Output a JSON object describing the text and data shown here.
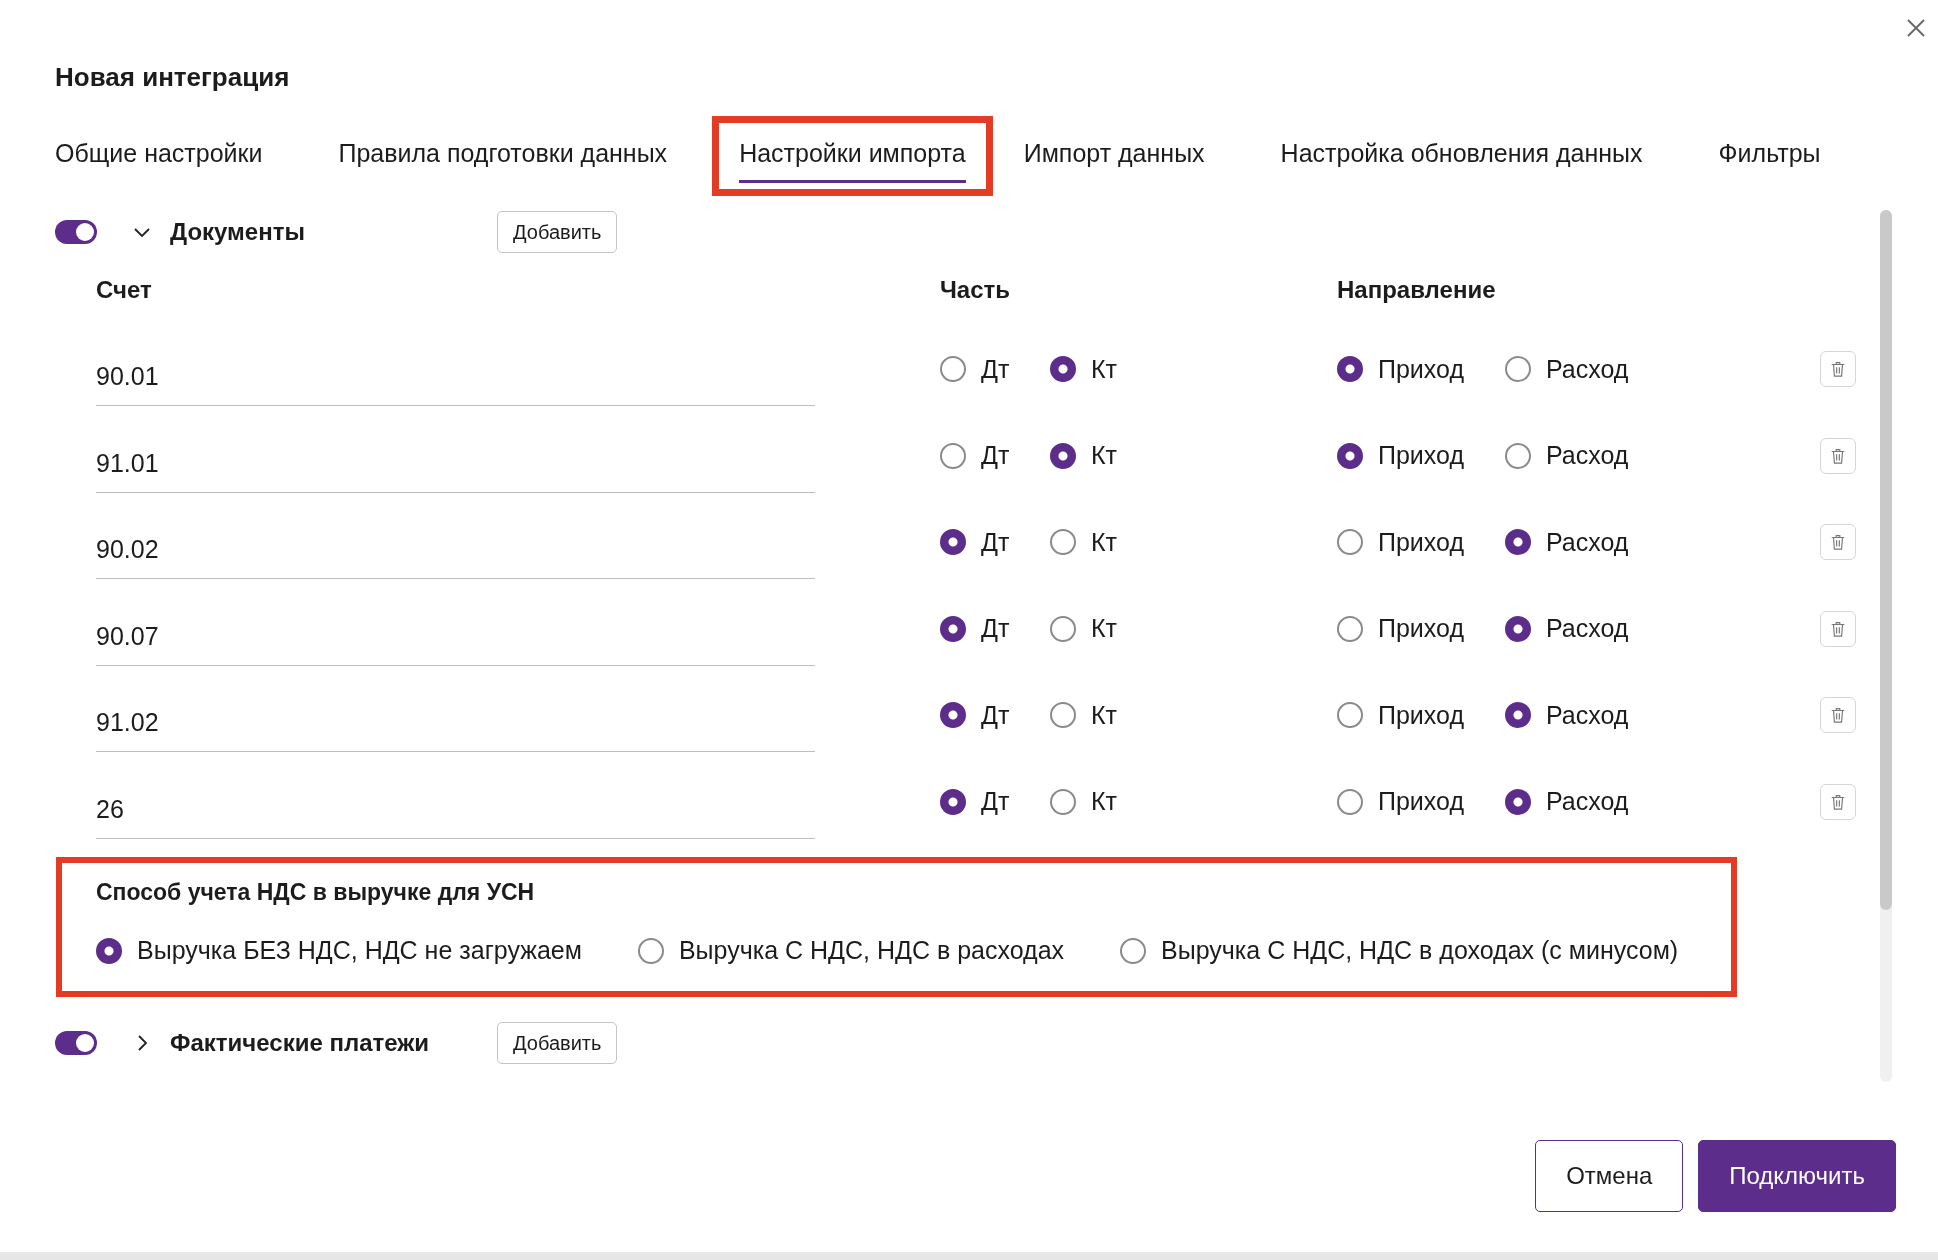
{
  "dialog": {
    "title": "Новая интеграция"
  },
  "tabs": [
    {
      "label": "Общие настройки",
      "selected": false,
      "highlighted": false
    },
    {
      "label": "Правила подготовки данных",
      "selected": false,
      "highlighted": false
    },
    {
      "label": "Настройки импорта",
      "selected": true,
      "highlighted": true
    },
    {
      "label": "Импорт данных",
      "selected": false,
      "highlighted": false
    },
    {
      "label": "Настройка обновления данных",
      "selected": false,
      "highlighted": false
    },
    {
      "label": "Фильтры",
      "selected": false,
      "highlighted": false
    }
  ],
  "sections": [
    {
      "title": "Документы",
      "enabled": true,
      "expanded": true,
      "add_button": "Добавить",
      "columns": [
        "Счет",
        "Часть",
        "Направление"
      ],
      "rows": [
        {
          "account": "90.01",
          "part": [
            {
              "label": "Дт",
              "selected": false
            },
            {
              "label": "Кт",
              "selected": true
            }
          ],
          "direction": [
            {
              "label": "Приход",
              "selected": true
            },
            {
              "label": "Расход",
              "selected": false
            }
          ]
        },
        {
          "account": "91.01",
          "part": [
            {
              "label": "Дт",
              "selected": false
            },
            {
              "label": "Кт",
              "selected": true
            }
          ],
          "direction": [
            {
              "label": "Приход",
              "selected": true
            },
            {
              "label": "Расход",
              "selected": false
            }
          ]
        },
        {
          "account": "90.02",
          "part": [
            {
              "label": "Дт",
              "selected": true
            },
            {
              "label": "Кт",
              "selected": false
            }
          ],
          "direction": [
            {
              "label": "Приход",
              "selected": false
            },
            {
              "label": "Расход",
              "selected": true
            }
          ]
        },
        {
          "account": "90.07",
          "part": [
            {
              "label": "Дт",
              "selected": true
            },
            {
              "label": "Кт",
              "selected": false
            }
          ],
          "direction": [
            {
              "label": "Приход",
              "selected": false
            },
            {
              "label": "Расход",
              "selected": true
            }
          ]
        },
        {
          "account": "91.02",
          "part": [
            {
              "label": "Дт",
              "selected": true
            },
            {
              "label": "Кт",
              "selected": false
            }
          ],
          "direction": [
            {
              "label": "Приход",
              "selected": false
            },
            {
              "label": "Расход",
              "selected": true
            }
          ]
        },
        {
          "account": "26",
          "part": [
            {
              "label": "Дт",
              "selected": true
            },
            {
              "label": "Кт",
              "selected": false
            }
          ],
          "direction": [
            {
              "label": "Приход",
              "selected": false
            },
            {
              "label": "Расход",
              "selected": true
            }
          ]
        }
      ],
      "vat_method": {
        "title": "Способ учета НДС в выручке для УСН",
        "highlighted": true,
        "options": [
          {
            "label": "Выручка БЕЗ НДС, НДС не загружаем",
            "selected": true
          },
          {
            "label": "Выручка С НДС, НДС в расходах",
            "selected": false
          },
          {
            "label": "Выручка С НДС, НДС в доходах (с минусом)",
            "selected": false
          }
        ]
      }
    },
    {
      "title": "Фактические платежи",
      "enabled": true,
      "expanded": false,
      "add_button": "Добавить"
    }
  ],
  "buttons": [
    {
      "label": "Отмена",
      "kind": "secondary"
    },
    {
      "label": "Подключить",
      "kind": "primary"
    }
  ]
}
